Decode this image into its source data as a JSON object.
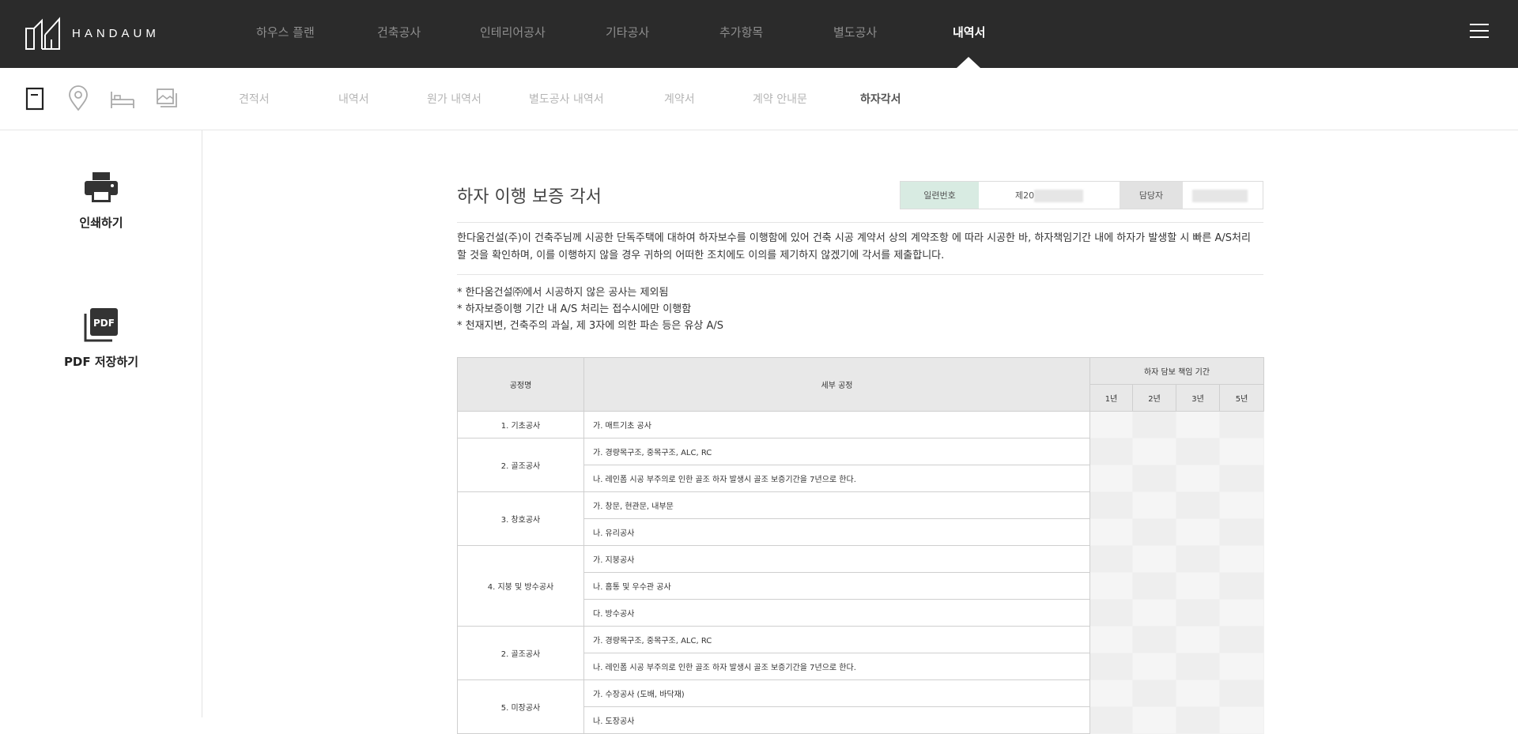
{
  "header": {
    "logo_text": "HANDAUM",
    "nav": [
      "하우스 플랜",
      "건축공사",
      "인테리어공사",
      "기타공사",
      "추가항목",
      "별도공사",
      "내역서"
    ],
    "active_nav_index": 6
  },
  "subheader": {
    "icons": [
      "document-icon",
      "location-pin-icon",
      "bed-icon",
      "image-icon"
    ],
    "tabs": [
      "견적서",
      "내역서",
      "원가 내역서",
      "별도공사 내역서",
      "계약서",
      "계약 안내문",
      "하자각서"
    ],
    "active_tab_index": 6
  },
  "sidebar": {
    "print_label": "인쇄하기",
    "pdf_label": "PDF 저장하기",
    "pdf_icon_text": "PDF"
  },
  "document": {
    "title": "하자 이행 보증 각서",
    "meta": {
      "serial_label": "일련번호",
      "serial_value": "제20",
      "manager_label": "담당자"
    },
    "paragraph": "한다움건설(주)이 건축주님께 시공한 단독주택에 대하여 하자보수를 이행함에 있어 건축 시공 계약서 상의 계약조항 에 따라 시공한 바, 하자책임기간 내에 하자가 발생할 시 빠른 A/S처리 할 것을 확인하며, 이를 이행하지 않을 경우 귀하의 어떠한 조치에도 이의를 제기하지 않겠기에 각서를 제출합니다.",
    "notes": [
      "* 한다움건설㈜에서 시공하지 않은 공사는 제외됨",
      "* 하자보증이행 기간 내 A/S 처리는 접수시에만 이행함",
      "* 천재지변, 건축주의 과실, 제 3자에 의한 파손 등은 유상 A/S"
    ],
    "table": {
      "headers": {
        "process": "공정명",
        "detail": "세부 공정",
        "period": "하자 담보 책임 기간",
        "years": [
          "1년",
          "2년",
          "3년",
          "5년"
        ]
      },
      "groups": [
        {
          "process": "1. 기초공사",
          "details": [
            "가. 매트기초 공사"
          ]
        },
        {
          "process": "2. 골조공사",
          "details": [
            "가. 경량목구조, 중목구조, ALC, RC",
            "나. 레인폼 시공 부주의로 인한 골조 하자 발생시 골조 보증기간을 7년으로 한다."
          ]
        },
        {
          "process": "3. 창호공사",
          "details": [
            "가. 창문, 현관문, 내부문",
            "나. 유리공사"
          ]
        },
        {
          "process": "4. 지붕 및 방수공사",
          "details": [
            "가. 지붕공사",
            "나. 홈통 및 우수관 공사",
            "다. 방수공사"
          ]
        },
        {
          "process": "2. 골조공사",
          "details": [
            "가. 경량목구조, 중목구조, ALC, RC",
            "나. 레인폼 시공 부주의로 인한 골조 하자 발생시 골조 보증기간을 7년으로 한다."
          ]
        },
        {
          "process": "5. 미장공사",
          "details": [
            "가. 수장공사 (도배, 바닥재)",
            "나. 도장공사"
          ]
        }
      ]
    }
  }
}
